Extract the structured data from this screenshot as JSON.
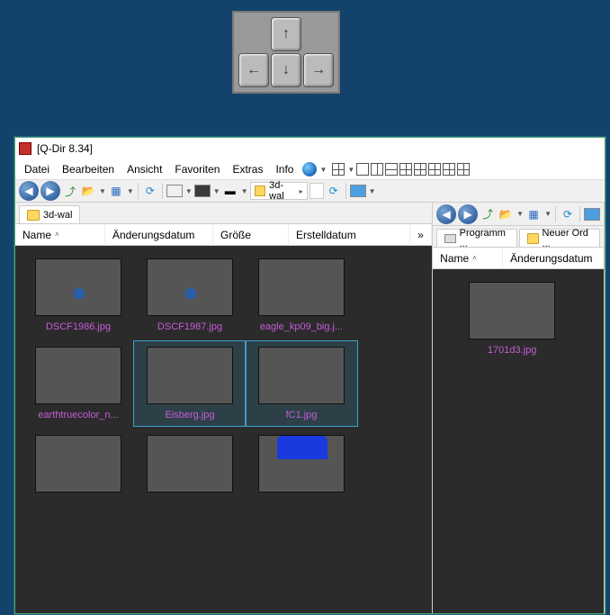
{
  "window": {
    "title": "[Q-Dir 8.34]"
  },
  "menu": {
    "file": "Datei",
    "edit": "Bearbeiten",
    "view": "Ansicht",
    "favorites": "Favoriten",
    "extras": "Extras",
    "info": "Info"
  },
  "left_toolbar": {
    "crumb_label": "3d-wal"
  },
  "left_tabs": {
    "tab1": "3d-wal"
  },
  "left_columns": {
    "name": "Name",
    "modified": "Änderungsdatum",
    "size": "Größe",
    "created": "Erstelldatum",
    "more": "»"
  },
  "left_files": [
    {
      "name": "DSCF1986.jpg",
      "art": "art-beach",
      "selected": false
    },
    {
      "name": "DSCF1987.jpg",
      "art": "art-beach",
      "selected": false
    },
    {
      "name": "eagle_kp09_big.j...",
      "art": "art-nebula",
      "selected": false
    },
    {
      "name": "earthtruecolor_n...",
      "art": "art-earth",
      "selected": false
    },
    {
      "name": "Eisberg.jpg",
      "art": "art-iceberg",
      "selected": true
    },
    {
      "name": "fC1.jpg",
      "art": "art-island",
      "selected": true
    },
    {
      "name": "",
      "art": "art-sunset",
      "selected": false
    },
    {
      "name": "",
      "art": "art-castle",
      "selected": false
    },
    {
      "name": "",
      "art": "art-smiley",
      "selected": false
    }
  ],
  "right_tabs": {
    "tab1": "Programm ...",
    "tab2": "Neuer Ord ..."
  },
  "right_columns": {
    "name": "Name",
    "modified": "Änderungsdatum"
  },
  "right_files": [
    {
      "name": "1701d3.jpg",
      "art": "art-globe"
    }
  ],
  "colors": {
    "swatch_left": "#4aa0e0",
    "swatch_right": "#3a3a3a"
  }
}
